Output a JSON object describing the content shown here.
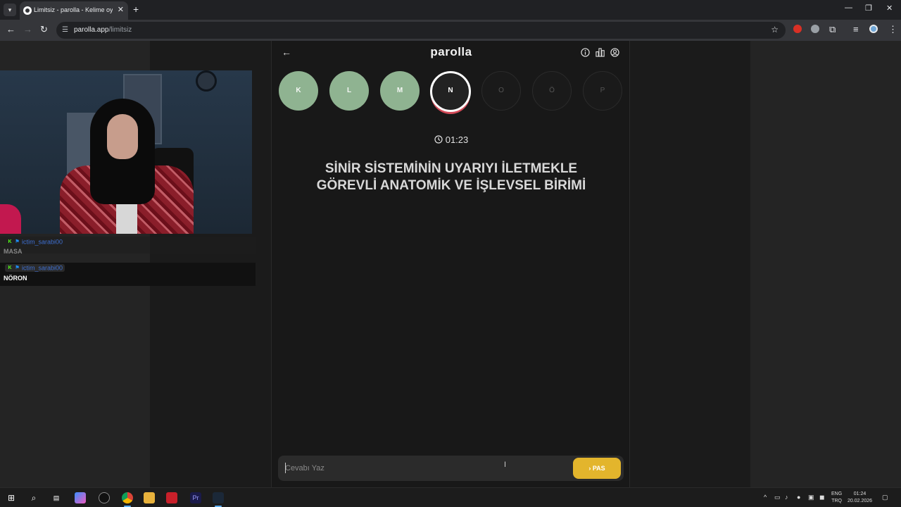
{
  "browser": {
    "tab_title": "Limitsiz - parolla - Kelime oyunu",
    "tab_close": "✕",
    "new_tab": "+",
    "minimize": "—",
    "restore": "❐",
    "close": "✕",
    "url_host": "parolla.app",
    "url_path": "/limitsiz"
  },
  "chat": {
    "messages": [
      {
        "username": "ictim_sarabi00",
        "text": "MASA"
      },
      {
        "username": "ictim_sarabi00",
        "text": "NÖRON"
      }
    ]
  },
  "game": {
    "brand": "parolla",
    "letters": [
      {
        "label": "K",
        "state": "done"
      },
      {
        "label": "L",
        "state": "done"
      },
      {
        "label": "M",
        "state": "done"
      },
      {
        "label": "N",
        "state": "current"
      },
      {
        "label": "O",
        "state": "pending"
      },
      {
        "label": "Ö",
        "state": "pending"
      },
      {
        "label": "P",
        "state": "pending"
      }
    ],
    "timer": "01:23",
    "question": "SİNİR SİSTEMİNİN UYARIYI İLETMEKLE GÖREVLİ ANATOMİK VE İŞLEVSEL BİRİMİ",
    "answer_placeholder": "Cevabı Yaz",
    "pass_button": "PAS",
    "colors": {
      "done": "#8fb391",
      "pass": "#e3b52c",
      "current_ring": "#d24a58"
    }
  },
  "taskbar": {
    "lang_top": "ENG",
    "lang_bottom": "TRQ",
    "time": "01:24",
    "date": "20.02.2026"
  }
}
